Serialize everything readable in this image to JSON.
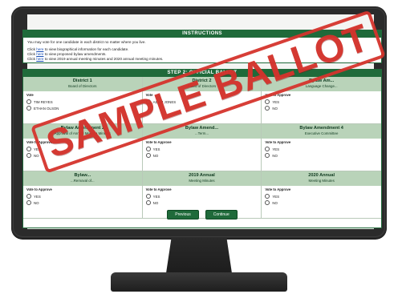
{
  "instructions": {
    "header": "INSTRUCTIONS",
    "line1": "You may vote for one candidate in each district no matter where you live.",
    "line2_pre": "Click ",
    "line2_link": "here",
    "line2_post": " to view biographical information for each candidate.",
    "line3_pre": "Click ",
    "line3_link": "here",
    "line3_post": " to view proposed bylaw amendments.",
    "line4_pre": "Click ",
    "line4_link": "here",
    "line4_post": " to view 2019 annual meeting minutes and 2020 annual meeting minutes."
  },
  "ballot": {
    "header": "STEP 2: OFFICIAL BALLOT",
    "cells": [
      {
        "title": "District 1",
        "subtitle": "Board of Directors",
        "prompt": "Vote",
        "options": [
          "TIM REYES",
          "ETHAN OLSON"
        ]
      },
      {
        "title": "District 2",
        "subtitle": "Board of Directors",
        "prompt": "Vote",
        "options": [
          "ADAM JONES"
        ]
      },
      {
        "title": "Bylaw Am...",
        "subtitle": "Language Change...",
        "prompt": "Vote to Approve",
        "options": [
          "YES",
          "NO"
        ]
      },
      {
        "title": "Bylaw Amendment 2",
        "subtitle": "Approval of Annual Meeting Minutes",
        "prompt": "Vote to Approve",
        "options": [
          "YES",
          "NO"
        ]
      },
      {
        "title": "Bylaw Amend...",
        "subtitle": "...Term...",
        "prompt": "Vote to Approve",
        "options": [
          "YES",
          "NO"
        ]
      },
      {
        "title": "Bylaw Amendment 4",
        "subtitle": "Executive Committee",
        "prompt": "Vote to Approve",
        "options": [
          "YES",
          "NO"
        ]
      },
      {
        "title": "Bylaw...",
        "subtitle": "...Removal of...",
        "prompt": "Vote to Approve",
        "options": [
          "YES",
          "NO"
        ]
      },
      {
        "title": "2019 Annual",
        "subtitle": "Meeting Minutes",
        "prompt": "Vote to Approve",
        "options": [
          "YES",
          "NO"
        ]
      },
      {
        "title": "2020 Annual",
        "subtitle": "Meeting Minutes",
        "prompt": "Vote to Approve",
        "options": [
          "YES",
          "NO"
        ]
      }
    ],
    "previous_label": "Previous",
    "continue_label": "Continue"
  },
  "stamp": {
    "text": "SAMPLE BALLOT"
  },
  "colors": {
    "accent_green": "#1f6a3a",
    "header_tint": "#b9d3b9",
    "stamp_red": "#d5342c",
    "bezel": "#2b2b2b"
  }
}
